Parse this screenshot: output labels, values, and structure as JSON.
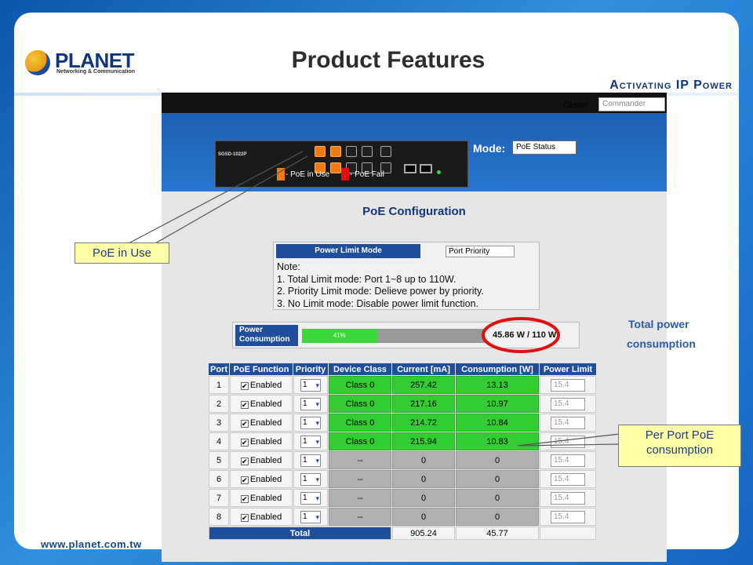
{
  "slide": {
    "title": "Product Features",
    "logo_text": "PLANET",
    "logo_subtitle": "Networking & Communication",
    "tagline": "Activating IP Power",
    "footer_url": "www.planet.com.tw"
  },
  "screenshot": {
    "cluster_label": "Cluster",
    "cluster_value": "Commander",
    "device_model": "SGSD-1022P",
    "mode_label": "Mode:",
    "mode_value": "PoE Status",
    "legend": [
      {
        "label": "- PoE in Use",
        "color": "#f07b14"
      },
      {
        "label": "- PoE Fail",
        "color": "#e01010"
      }
    ],
    "poe_title": "PoE Configuration",
    "power_limit_mode": {
      "label": "Power Limit Mode",
      "value": "Port Priority",
      "note": "Note:\n1. Total Limit mode: Port 1~8 up to 110W.\n2. Priority Limit mode: Delieve power by priority.\n3. No Limit mode: Disable power limit function."
    },
    "power_consumption": {
      "label": "Power Consumption",
      "percent": 41,
      "percent_label": "41%",
      "value": "45.86 W / 110 W"
    },
    "table": {
      "headers": [
        "Port",
        "PoE Function",
        "Priority",
        "Device Class",
        "Current [mA]",
        "Consumption [W]",
        "Power Limit"
      ],
      "rows": [
        {
          "port": "1",
          "function": "Enabled",
          "priority": "1",
          "class": "Class 0",
          "current": "257.42",
          "consumption": "13.13",
          "limit": "15.4",
          "active": true
        },
        {
          "port": "2",
          "function": "Enabled",
          "priority": "1",
          "class": "Class 0",
          "current": "217.16",
          "consumption": "10.97",
          "limit": "15.4",
          "active": true
        },
        {
          "port": "3",
          "function": "Enabled",
          "priority": "1",
          "class": "Class 0",
          "current": "214.72",
          "consumption": "10.84",
          "limit": "15.4",
          "active": true
        },
        {
          "port": "4",
          "function": "Enabled",
          "priority": "1",
          "class": "Class 0",
          "current": "215.94",
          "consumption": "10.83",
          "limit": "15.4",
          "active": true
        },
        {
          "port": "5",
          "function": "Enabled",
          "priority": "1",
          "class": "--",
          "current": "0",
          "consumption": "0",
          "limit": "15.4",
          "active": false
        },
        {
          "port": "6",
          "function": "Enabled",
          "priority": "1",
          "class": "--",
          "current": "0",
          "consumption": "0",
          "limit": "15.4",
          "active": false
        },
        {
          "port": "7",
          "function": "Enabled",
          "priority": "1",
          "class": "--",
          "current": "0",
          "consumption": "0",
          "limit": "15.4",
          "active": false
        },
        {
          "port": "8",
          "function": "Enabled",
          "priority": "1",
          "class": "--",
          "current": "0",
          "consumption": "0",
          "limit": "15.4",
          "active": false
        }
      ],
      "total": {
        "label": "Total",
        "current": "905.24",
        "consumption": "45.77"
      }
    }
  },
  "annotations": {
    "poe_in_use": "PoE in Use",
    "total_power_line1": "Total power",
    "total_power_line2": "consumption",
    "per_port": "Per Port PoE consumption"
  },
  "colors": {
    "brand_blue": "#11357a",
    "header_blue": "#1f4f9c",
    "poe_green": "#33cc33",
    "highlight_red": "#e01010",
    "callout_yellow": "#ffffa8"
  }
}
